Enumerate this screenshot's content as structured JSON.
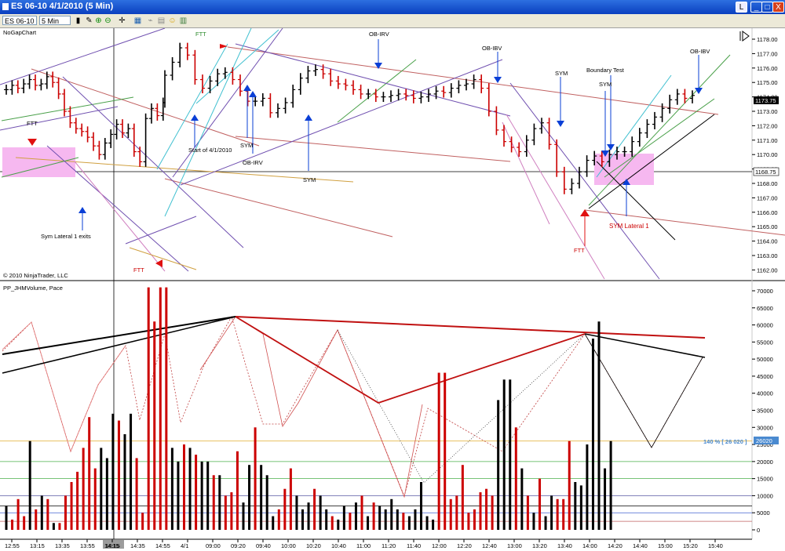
{
  "window": {
    "title": "ES 06-10  4/1/2010 (5 Min)",
    "buttons": [
      "L",
      "_",
      "□",
      "X"
    ]
  },
  "toolbar": {
    "instrument": "ES 06-10",
    "interval": "5 Min"
  },
  "price_panel": {
    "label": "NoGapChart",
    "copyright": "© 2010 NinjaTrader, LLC",
    "last_price": "1173.75",
    "line_price": "1168.75",
    "ticks": [
      "1178.00",
      "1177.00",
      "1176.00",
      "1175.00",
      "1174.00",
      "1173.00",
      "1172.00",
      "1171.00",
      "1170.00",
      "1169.00",
      "1168.00",
      "1167.00",
      "1166.00",
      "1165.00",
      "1164.00",
      "1163.00",
      "1162.00"
    ]
  },
  "annotations": {
    "ftt_top": "FTT",
    "ftt_left": "FTT",
    "ftt_bottom": "FTT",
    "ftt_right": "FTT",
    "ob_irv_top": "OB-IRV",
    "ob_ibv_mid": "OB-IBV",
    "ob_ibv_right": "OB-IBV",
    "sym_1": "SYM",
    "sym_2": "SYM",
    "sym_3": "SYM",
    "ob_irv_low": "OB-IRV",
    "sym_low": "SYM",
    "boundary_test": "Boundary Test",
    "start_of_day": "Start of 4/1/2010",
    "sym_lateral_exits": "Sym Lateral 1 exits",
    "sym_lateral_1": "SYM Lateral 1"
  },
  "volume_panel": {
    "label": "PP_JHMVolume, Pace",
    "pace_label": "140 % [ 26 020 ]",
    "pace_value": "26020",
    "ticks": [
      "70000",
      "65000",
      "60000",
      "55000",
      "50000",
      "45000",
      "40000",
      "35000",
      "30000",
      "25000",
      "20000",
      "15000",
      "10000",
      "5000",
      "0"
    ]
  },
  "time_axis": [
    "12:55",
    "13:15",
    "13:35",
    "13:55",
    "14:15",
    "14:35",
    "14:55",
    "4/1",
    "09:00",
    "09:20",
    "09:40",
    "10:00",
    "10:20",
    "10:40",
    "11:00",
    "11:20",
    "11:40",
    "12:00",
    "12:20",
    "12:40",
    "13:00",
    "13:20",
    "13:40",
    "14:00",
    "14:20",
    "14:40",
    "15:00",
    "15:20",
    "15:40"
  ],
  "colors": {
    "up": "#000000",
    "down": "#cc0000",
    "zone": "#f6b8f0",
    "arrow_blue": "#0a3fd6",
    "arrow_red": "#e01010",
    "pace_text": "#4a8ad0"
  },
  "chart_data": {
    "type": "bar",
    "categories": [
      "12:55",
      "13:00",
      "13:05",
      "13:10",
      "13:15",
      "13:20",
      "13:25",
      "13:30",
      "13:35",
      "13:40",
      "13:45",
      "13:50",
      "13:55",
      "14:00",
      "14:05",
      "14:10",
      "14:15",
      "14:20",
      "14:25",
      "14:30",
      "14:35",
      "14:40",
      "14:45",
      "14:50",
      "14:55",
      "15:00",
      "15:05",
      "15:10",
      "09:00",
      "09:05",
      "09:10",
      "09:15",
      "09:20",
      "09:25",
      "09:30",
      "09:35",
      "09:40",
      "09:45",
      "09:50",
      "09:55",
      "10:00",
      "10:05",
      "10:10",
      "10:15",
      "10:20",
      "10:25",
      "10:30",
      "10:35",
      "10:40",
      "10:45",
      "10:50",
      "10:55",
      "11:00",
      "11:05",
      "11:10",
      "11:15",
      "11:20",
      "11:25",
      "11:30",
      "11:35",
      "11:40",
      "11:45",
      "11:50",
      "11:55",
      "12:00",
      "12:05",
      "12:10",
      "12:15",
      "12:20",
      "12:25",
      "12:30",
      "12:35",
      "12:40",
      "12:45",
      "12:50",
      "12:55",
      "13:00",
      "13:05",
      "13:10",
      "13:15",
      "13:20",
      "13:25",
      "13:30",
      "13:35",
      "13:40",
      "13:45",
      "13:50",
      "13:55",
      "14:00",
      "14:05",
      "14:10",
      "14:15",
      "14:20",
      "14:25",
      "14:30",
      "14:35",
      "14:40",
      "14:45",
      "14:50",
      "14:55",
      "15:00",
      "15:05",
      "15:10"
    ],
    "series": [
      {
        "name": "Volume",
        "values": [
          7000,
          3000,
          9000,
          4000,
          26000,
          6000,
          10000,
          9000,
          2000,
          2000,
          10000,
          14000,
          17000,
          24000,
          33000,
          18000,
          24000,
          21000,
          34000,
          32000,
          28000,
          34000,
          21000,
          5000,
          71000,
          61000,
          71000,
          71000,
          24000,
          20000,
          25000,
          24000,
          22000,
          20000,
          20000,
          16000,
          16000,
          10000,
          11000,
          23000,
          8000,
          19000,
          30000,
          19000,
          16000,
          4000,
          6000,
          12000,
          18000,
          10000,
          6000,
          8000,
          12000,
          10000,
          6000,
          4000,
          3000,
          7000,
          5000,
          8000,
          10000,
          4000,
          8000,
          7000,
          6000,
          9000,
          6000,
          5000,
          4000,
          6000,
          14000,
          4000,
          3000,
          46000,
          46000,
          9000,
          10000,
          19000,
          5000,
          6000,
          11000,
          12000,
          10000,
          38000,
          44000,
          44000,
          30000,
          18000,
          10000,
          5000,
          15000,
          4000,
          10000,
          9000,
          9000,
          26000,
          14000,
          13000,
          25000,
          56000,
          61000,
          18000,
          26000
        ]
      }
    ],
    "down_bars": [
      1,
      2,
      3,
      5,
      7,
      9,
      10,
      11,
      12,
      13,
      14,
      15,
      19,
      22,
      23,
      24,
      25,
      26,
      27,
      30,
      32,
      35,
      37,
      38,
      39,
      42,
      46,
      47,
      48,
      52,
      55,
      58,
      60,
      62,
      67,
      73,
      74,
      75,
      76,
      77,
      78,
      79,
      80,
      81,
      82,
      86,
      88,
      90,
      93,
      94,
      95
    ],
    "price_axis_range": [
      1162,
      1178.5
    ],
    "volume_axis_range": [
      0,
      70000
    ],
    "pace_line": 26020,
    "reference_lines": [
      20000,
      15000,
      10000,
      7000,
      5000
    ]
  }
}
